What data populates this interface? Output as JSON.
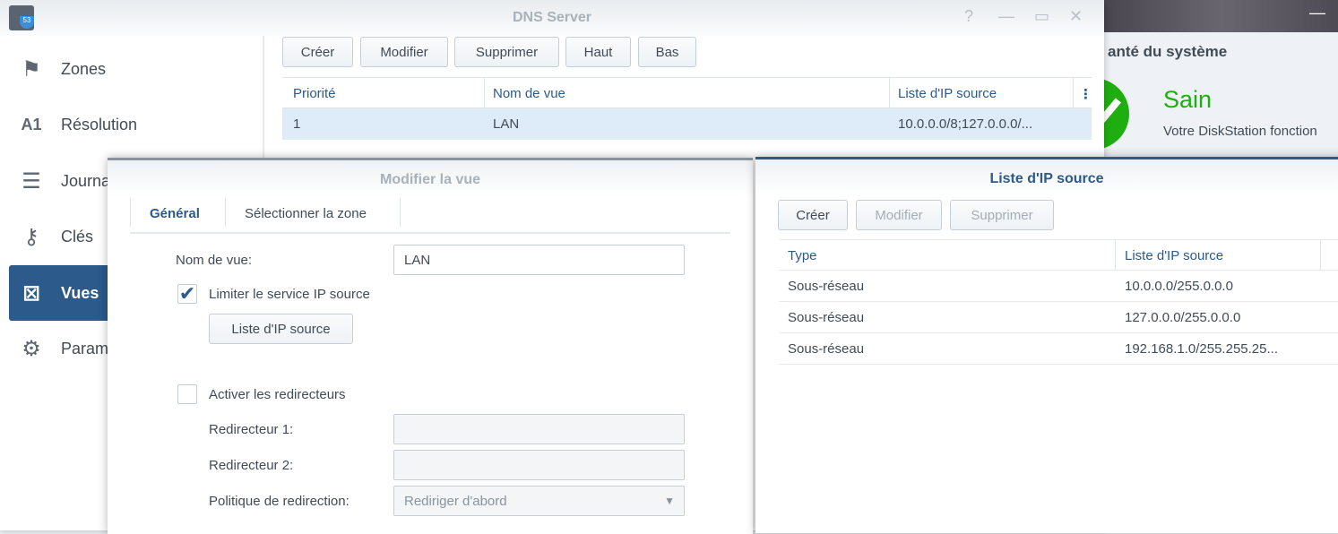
{
  "background": {
    "health_title": "anté du système",
    "status": "Sain",
    "status_desc": "Votre DiskStation fonction",
    "status_color": "#1fae10"
  },
  "dns": {
    "title": "DNS Server",
    "sidebar": [
      {
        "label": "Zones",
        "icon": "flag-icon"
      },
      {
        "label": "Résolution",
        "icon": "resolution-icon"
      },
      {
        "label": "Journal",
        "icon": "log-icon"
      },
      {
        "label": "Clés",
        "icon": "key-icon"
      },
      {
        "label": "Vues",
        "icon": "views-icon"
      },
      {
        "label": "Paramè",
        "icon": "gear-icon"
      }
    ],
    "toolbar": {
      "create": "Créer",
      "edit": "Modifier",
      "delete": "Supprimer",
      "up": "Haut",
      "down": "Bas"
    },
    "table": {
      "headers": [
        "Priorité",
        "Nom de vue",
        "Liste d'IP source"
      ],
      "rows": [
        [
          "1",
          "LAN",
          "10.0.0.0/8;127.0.0.0/..."
        ]
      ]
    }
  },
  "edit_view": {
    "title": "Modifier la vue",
    "tabs": [
      "Général",
      "Sélectionner la zone"
    ],
    "view_name_label": "Nom de vue:",
    "view_name": "LAN",
    "limit_label": "Limiter le service IP source",
    "limit_checked": true,
    "ip_list_button": "Liste d'IP source",
    "forwarders_label": "Activer les redirecteurs",
    "forwarders_checked": false,
    "fwd1_label": "Redirecteur 1:",
    "fwd1": "",
    "fwd2_label": "Redirecteur 2:",
    "fwd2": "",
    "policy_label": "Politique de redirection:",
    "policy": "Rediriger d'abord"
  },
  "ip_list": {
    "title": "Liste d'IP source",
    "toolbar": {
      "create": "Créer",
      "edit": "Modifier",
      "delete": "Supprimer"
    },
    "headers": [
      "Type",
      "Liste d'IP source"
    ],
    "rows": [
      [
        "Sous-réseau",
        "10.0.0.0/255.0.0.0"
      ],
      [
        "Sous-réseau",
        "127.0.0.0/255.0.0.0"
      ],
      [
        "Sous-réseau",
        "192.168.1.0/255.255.25..."
      ]
    ]
  }
}
